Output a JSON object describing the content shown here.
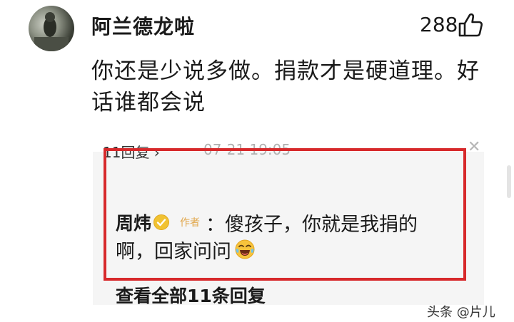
{
  "comment": {
    "author": "阿兰德龙啦",
    "likes": "288",
    "text": "你还是少说多做。捐款才是硬道理。好话谁都会说",
    "avatar_icon": "avatar-photo"
  },
  "replies": {
    "count_label": "11回复 ›",
    "time": "07-21 19:05",
    "close_icon": "close-icon",
    "items": [
      {
        "author": "周炜",
        "badge": "作者",
        "text_line1": "：傻孩子，你就是我捐的",
        "text_line2": "啊，回家问问",
        "verified_icon": "verified-icon",
        "emoji_icon": "laughing-crying-emoji"
      }
    ],
    "view_all": "查看全部11条回复"
  },
  "highlight": {
    "color": "#d7292b"
  },
  "watermark": "头条 @片儿"
}
